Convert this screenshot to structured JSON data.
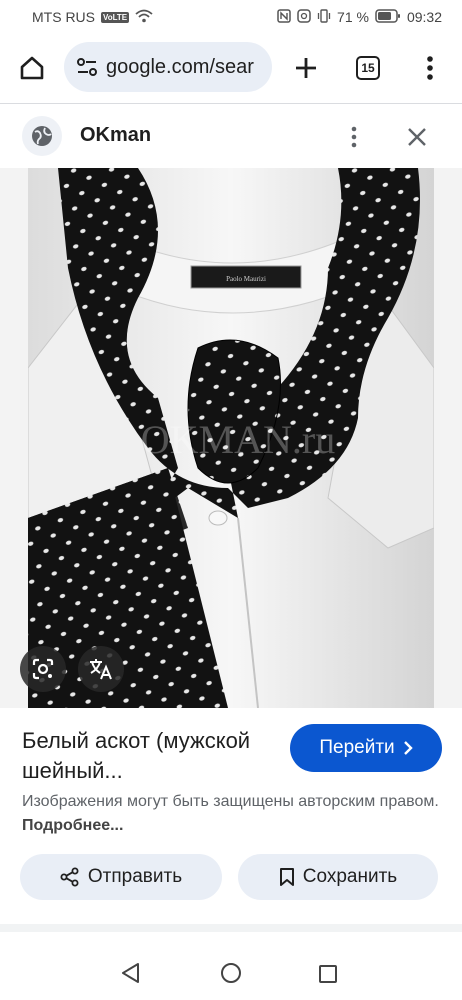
{
  "status_bar": {
    "carrier": "MTS RUS",
    "volte": "VoLTE",
    "battery": "71 %",
    "time": "09:32"
  },
  "browser": {
    "url": "google.com/sear",
    "tab_count": "15"
  },
  "source": {
    "site_name": "OKman"
  },
  "image": {
    "watermark": "OKMAN.ru",
    "brand_label": "Paolo Maurizi"
  },
  "result": {
    "title": "Белый аскот (мужской шейный...",
    "visit_label": "Перейти",
    "copyright_text": "Изображения могут быть защищены авторским правом.",
    "more_link": "Подробнее...",
    "share_label": "Отправить",
    "save_label": "Сохранить"
  },
  "colors": {
    "accent": "#0b57d0",
    "chip_bg": "#e9eef6"
  }
}
